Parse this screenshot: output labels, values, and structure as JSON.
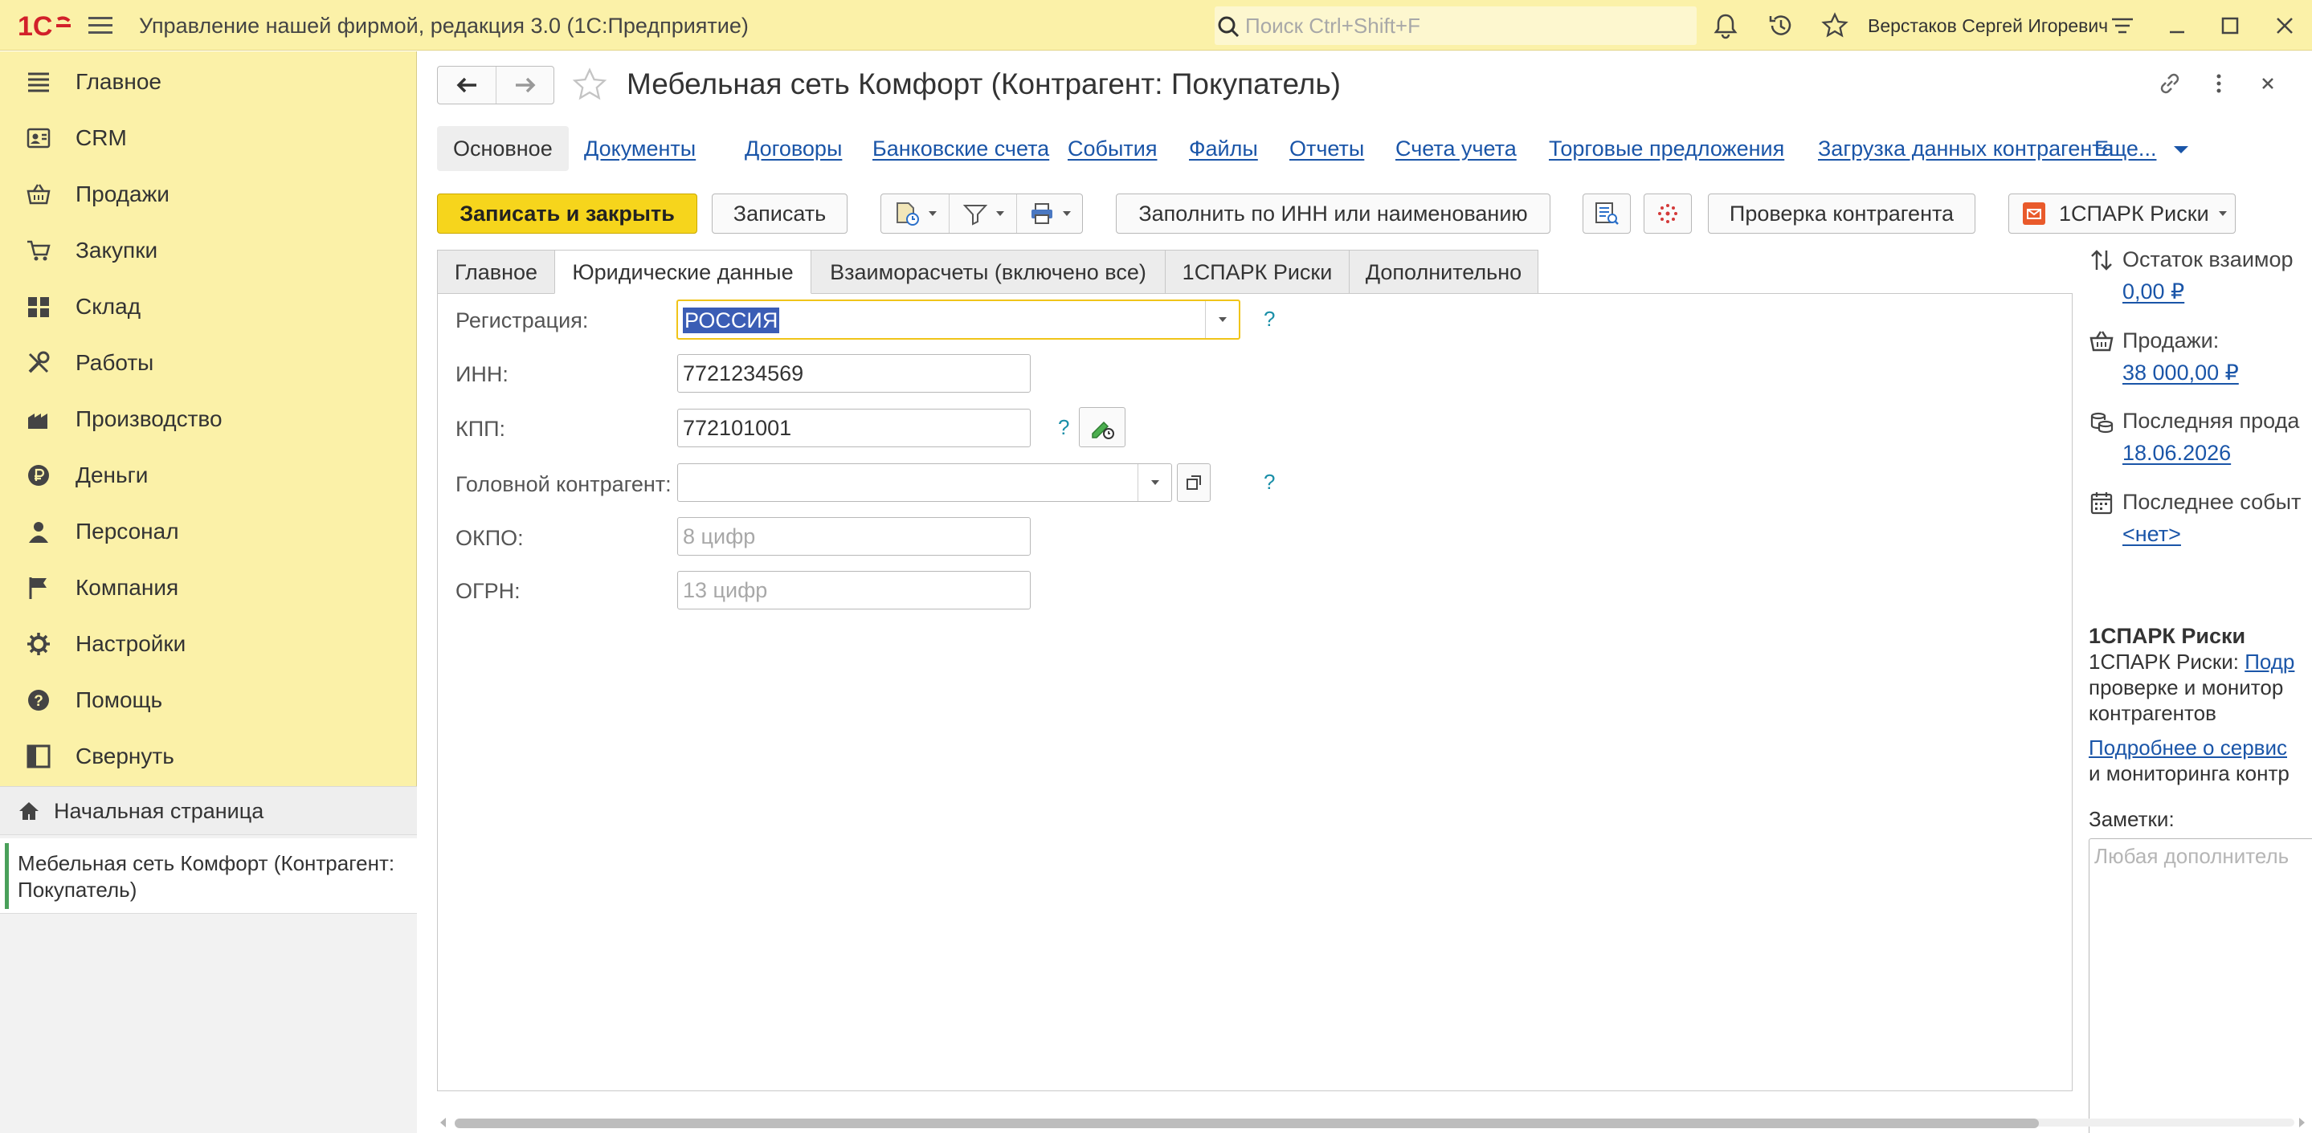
{
  "titlebar": {
    "app_title": "Управление нашей фирмой, редакция 3.0  (1С:Предприятие)",
    "search_placeholder": "Поиск Ctrl+Shift+F",
    "user": "Верстаков Сергей Игоревич"
  },
  "sidebar": {
    "items": [
      {
        "label": "Главное",
        "icon": "list-icon"
      },
      {
        "label": "CRM",
        "icon": "contact-card-icon"
      },
      {
        "label": "Продажи",
        "icon": "basket-icon"
      },
      {
        "label": "Закупки",
        "icon": "cart-icon"
      },
      {
        "label": "Склад",
        "icon": "warehouse-grid-icon"
      },
      {
        "label": "Работы",
        "icon": "tools-icon"
      },
      {
        "label": "Производство",
        "icon": "factory-icon"
      },
      {
        "label": "Деньги",
        "icon": "ruble-coin-icon"
      },
      {
        "label": "Персонал",
        "icon": "person-icon"
      },
      {
        "label": "Компания",
        "icon": "flag-icon"
      },
      {
        "label": "Настройки",
        "icon": "gear-icon"
      },
      {
        "label": "Помощь",
        "icon": "help-icon"
      },
      {
        "label": "Свернуть",
        "icon": "collapse-panel-icon"
      }
    ],
    "home": "Начальная страница",
    "open_doc": "Мебельная сеть Комфорт (Контрагент: Покупатель)"
  },
  "doc": {
    "title": "Мебельная сеть Комфорт (Контрагент: Покупатель)"
  },
  "panel_tabs": [
    "Основное",
    "Документы",
    "Договоры",
    "Банковские счета",
    "События",
    "Файлы",
    "Отчеты",
    "Счета учета",
    "Торговые предложения",
    "Загрузка данных контрагента",
    "Еще..."
  ],
  "toolbar": {
    "save_close": "Записать и закрыть",
    "save": "Записать",
    "fill_inn": "Заполнить по ИНН или наименованию",
    "check": "Проверка контрагента",
    "spark": "1СПАРК Риски"
  },
  "form_tabs": [
    "Главное",
    "Юридические данные",
    "Взаиморасчеты (включено все)",
    "1СПАРК Риски",
    "Дополнительно"
  ],
  "form": {
    "registration_label": "Регистрация:",
    "registration_value": "РОССИЯ",
    "inn_label": "ИНН:",
    "inn_value": "7721234569",
    "kpp_label": "КПП:",
    "kpp_value": "772101001",
    "head_label": "Головной контрагент:",
    "head_value": "",
    "okpo_label": "ОКПО:",
    "okpo_placeholder": "8 цифр",
    "ogrn_label": "ОГРН:",
    "ogrn_placeholder": "13 цифр",
    "help_mark": "?"
  },
  "info": {
    "balance_label": "Остаток взаимор",
    "balance_value": "0,00 ₽",
    "sales_label": "Продажи:",
    "sales_value": "38 000,00 ₽",
    "last_sale_label": "Последняя прода",
    "last_sale_value": "18.06.2026",
    "last_event_label": "Последнее событ",
    "last_event_value": "<нет>",
    "spark_heading": "1СПАРК Риски",
    "spark_line1_prefix": "1СПАРК Риски: ",
    "spark_line1_link": "Подр",
    "spark_line2": "проверке и монитор",
    "spark_line3": "контрагентов",
    "spark_more_link": "Подробнее о сервис",
    "spark_line5": "и мониторинга контр",
    "notes_label": "Заметки:",
    "notes_placeholder": "Любая дополнитель"
  }
}
